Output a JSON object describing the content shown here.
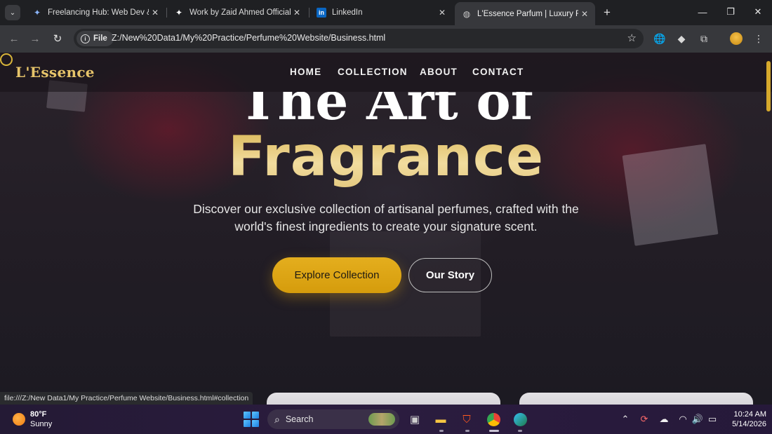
{
  "browser": {
    "tabs": [
      {
        "title": "Freelancing Hub: Web Dev & Yo",
        "icon": "sparkle-icon"
      },
      {
        "title": "Work by Zaid Ahmed Official",
        "icon": "sparkle-icon"
      },
      {
        "title": "LinkedIn",
        "icon": "linkedin-icon"
      },
      {
        "title": "L'Essence Parfum | Luxury Fragr",
        "icon": "globe-icon",
        "active": true
      }
    ],
    "address": {
      "scheme_label": "File",
      "url": "Z:/New%20Data1/My%20Practice/Perfume%20Website/Business.html"
    },
    "status_url": "file:///Z:/New Data1/My Practice/Perfume Website/Business.html#collection"
  },
  "site": {
    "logo": "L'Essence",
    "nav": [
      "HOME",
      "COLLECTION",
      "ABOUT",
      "CONTACT"
    ],
    "hero": {
      "line1": "The Art of",
      "line2": "Fragrance",
      "subtitle": "Discover our exclusive collection of artisanal perfumes, crafted with the world's finest ingredients to create your signature scent.",
      "primary_cta": "Explore Collection",
      "secondary_cta": "Our Story"
    }
  },
  "taskbar": {
    "weather": {
      "temp": "80°F",
      "condition": "Sunny"
    },
    "search_label": "Search",
    "time": "10:24 AM",
    "date": "5/14/2026"
  },
  "colors": {
    "accent_gold": "#d59c0c",
    "logo_gold": "#e6c46a"
  }
}
